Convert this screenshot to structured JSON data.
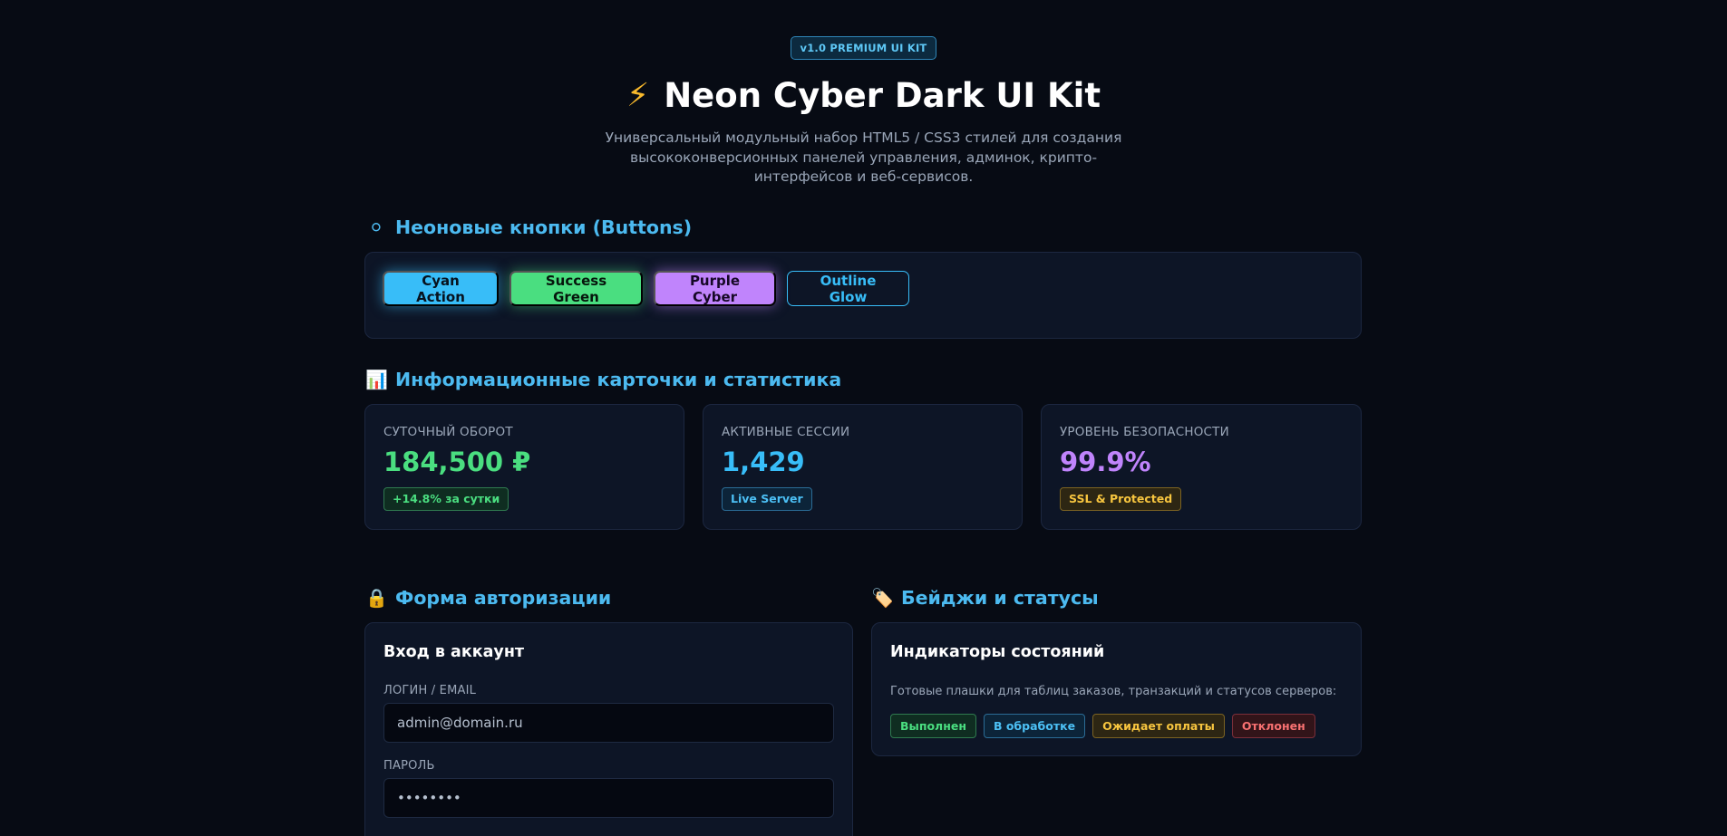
{
  "hero": {
    "version": "v1.0 PREMIUM UI KIT",
    "title_icon": "⚡",
    "title": "Neon Cyber Dark UI Kit",
    "subtitle": "Универсальный модульный набор HTML5 / CSS3 стилей для создания высококонверсионных панелей управления, админок, крипто-интерфейсов и веб-сервисов."
  },
  "sections": {
    "buttons": {
      "icon": "⚪",
      "title": "Неоновые кнопки (Buttons)"
    },
    "stats": {
      "icon": "📊",
      "title": "Информационные карточки и статистика"
    },
    "auth": {
      "icon": "🔒",
      "title": "Форма авторизации"
    },
    "badges": {
      "icon": "🏷️",
      "title": "Бейджи и статусы"
    }
  },
  "buttons": {
    "cyan": "Cyan Action",
    "green": "Success Green",
    "purple": "Purple Cyber",
    "outline": "Outline Glow"
  },
  "stats": [
    {
      "label": "СУТОЧНЫЙ ОБОРОТ",
      "value": "184,500 ₽",
      "chip": "+14.8% за сутки",
      "color": "#4ade80"
    },
    {
      "label": "АКТИВНЫЕ СЕССИИ",
      "value": "1,429",
      "chip": "Live Server",
      "color": "#38bdf8"
    },
    {
      "label": "УРОВЕНЬ БЕЗОПАСНОСТИ",
      "value": "99.9%",
      "chip": "SSL & Protected",
      "color": "#c084fc"
    }
  ],
  "login": {
    "title": "Вход в аккаунт",
    "login_label": "ЛОГИН / EMAIL",
    "login_value": "admin@domain.ru",
    "password_label": "ПАРОЛЬ",
    "password_value": "••••••••"
  },
  "badges": {
    "title": "Индикаторы состояний",
    "description": "Готовые плашки для таблиц заказов, транзакций и статусов серверов:",
    "items": [
      "Выполнен",
      "В обработке",
      "Ожидает оплаты",
      "Отклонен"
    ]
  }
}
